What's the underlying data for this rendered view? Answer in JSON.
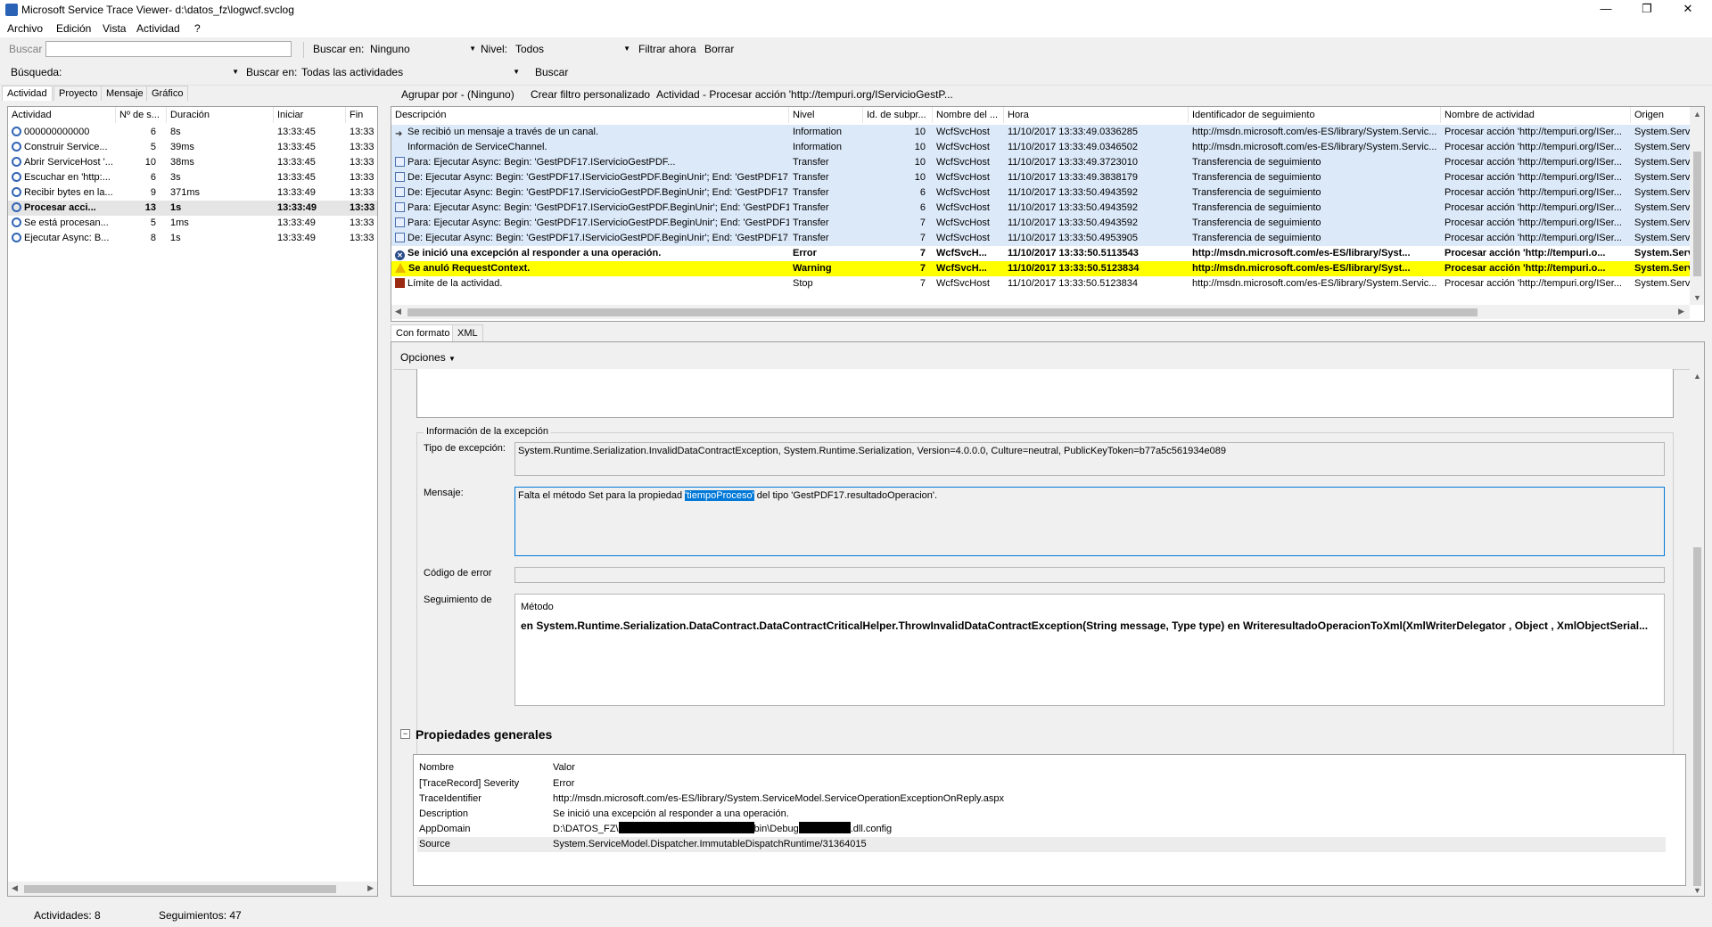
{
  "window": {
    "title": "Microsoft Service Trace Viewer- d:\\datos_fz\\logwcf.svclog",
    "minimize": "—",
    "maximize": "❐",
    "close": "✕"
  },
  "menu": [
    "Archivo",
    "Edición",
    "Vista",
    "Actividad",
    "?"
  ],
  "toolbar1": {
    "search_label": "Buscar",
    "search_value": "",
    "search_in_label": "Buscar en:",
    "search_in_value": "Ninguno",
    "level_label": "Nivel:",
    "level_value": "Todos",
    "filter_now": "Filtrar ahora",
    "clear": "Borrar"
  },
  "toolbar2": {
    "search_label": "Búsqueda:",
    "search_value": "",
    "search_in_label": "Buscar en:",
    "search_in_value": "Todas las actividades",
    "search_button": "Buscar"
  },
  "left_tabs": [
    "Actividad",
    "Proyecto",
    "Mensaje",
    "Gráfico"
  ],
  "right_toolbar": {
    "group_by": "Agrupar por - (Ninguno)",
    "create_filter": "Crear filtro personalizado",
    "activity": "Actividad - Procesar acción 'http://tempuri.org/IServicioGestP..."
  },
  "activity_list": {
    "headers": [
      "Actividad",
      "Nº de s...",
      "Duración",
      "Iniciar",
      "Fin"
    ],
    "rows": [
      {
        "icon": "activity",
        "name": "000000000000",
        "count": "6",
        "duration": "8s",
        "start": "13:33:45",
        "end": "13:33",
        "bold": false
      },
      {
        "icon": "activity",
        "name": "Construir Service...",
        "count": "5",
        "duration": "39ms",
        "start": "13:33:45",
        "end": "13:33",
        "bold": false
      },
      {
        "icon": "activity",
        "name": "Abrir ServiceHost '...",
        "count": "10",
        "duration": "38ms",
        "start": "13:33:45",
        "end": "13:33",
        "bold": false
      },
      {
        "icon": "activity",
        "name": "Escuchar en 'http:...",
        "count": "6",
        "duration": "3s",
        "start": "13:33:45",
        "end": "13:33",
        "bold": false
      },
      {
        "icon": "activity",
        "name": "Recibir bytes en la...",
        "count": "9",
        "duration": "371ms",
        "start": "13:33:49",
        "end": "13:33",
        "bold": false
      },
      {
        "icon": "activity",
        "name": "Procesar acci...",
        "count": "13",
        "duration": "1s",
        "start": "13:33:49",
        "end": "13:33",
        "bold": true
      },
      {
        "icon": "activity",
        "name": "Se está procesan...",
        "count": "5",
        "duration": "1ms",
        "start": "13:33:49",
        "end": "13:33",
        "bold": false
      },
      {
        "icon": "activity",
        "name": "Ejecutar Async: B...",
        "count": "8",
        "duration": "1s",
        "start": "13:33:49",
        "end": "13:33",
        "bold": false
      }
    ]
  },
  "trace_list": {
    "headers": [
      "Descripción",
      "Nivel",
      "Id. de subpr...",
      "Nombre del ...",
      "Hora",
      "Identificador de seguimiento",
      "Nombre de actividad",
      "Origen"
    ],
    "rows": [
      {
        "icon": "arrow",
        "desc": "Se recibió un mensaje a través de un canal.",
        "level": "Information",
        "tid": "10",
        "proc": "WcfSvcHost",
        "time": "11/10/2017 13:33:49.0336285",
        "trace": "http://msdn.microsoft.com/es-ES/library/System.Servic...",
        "act": "Procesar acción 'http://tempuri.org/ISer...",
        "src": "System.Servic",
        "style": "blue"
      },
      {
        "icon": "blank",
        "desc": "Información de ServiceChannel.",
        "level": "Information",
        "tid": "10",
        "proc": "WcfSvcHost",
        "time": "11/10/2017 13:33:49.0346502",
        "trace": "http://msdn.microsoft.com/es-ES/library/System.Servic...",
        "act": "Procesar acción 'http://tempuri.org/ISer...",
        "src": "System.Servic",
        "style": "blue"
      },
      {
        "icon": "msg",
        "desc": "Para: Ejecutar Async: Begin: 'GestPDF17.IServicioGestPDF...",
        "level": "Transfer",
        "tid": "10",
        "proc": "WcfSvcHost",
        "time": "11/10/2017 13:33:49.3723010",
        "trace": "Transferencia de seguimiento",
        "act": "Procesar acción 'http://tempuri.org/ISer...",
        "src": "System.Servic",
        "style": "blue"
      },
      {
        "icon": "msg",
        "desc": "De: Ejecutar Async: Begin: 'GestPDF17.IServicioGestPDF.BeginUnir'; End: 'GestPDF17...",
        "level": "Transfer",
        "tid": "10",
        "proc": "WcfSvcHost",
        "time": "11/10/2017 13:33:49.3838179",
        "trace": "Transferencia de seguimiento",
        "act": "Procesar acción 'http://tempuri.org/ISer...",
        "src": "System.Servic",
        "style": "blue"
      },
      {
        "icon": "msg",
        "desc": "De: Ejecutar Async: Begin: 'GestPDF17.IServicioGestPDF.BeginUnir'; End: 'GestPDF17...",
        "level": "Transfer",
        "tid": "6",
        "proc": "WcfSvcHost",
        "time": "11/10/2017 13:33:50.4943592",
        "trace": "Transferencia de seguimiento",
        "act": "Procesar acción 'http://tempuri.org/ISer...",
        "src": "System.Servic",
        "style": "blue"
      },
      {
        "icon": "msg",
        "desc": "Para: Ejecutar Async: Begin: 'GestPDF17.IServicioGestPDF.BeginUnir'; End: 'GestPDF17...",
        "level": "Transfer",
        "tid": "6",
        "proc": "WcfSvcHost",
        "time": "11/10/2017 13:33:50.4943592",
        "trace": "Transferencia de seguimiento",
        "act": "Procesar acción 'http://tempuri.org/ISer...",
        "src": "System.Servic",
        "style": "blue"
      },
      {
        "icon": "msg",
        "desc": "Para: Ejecutar Async: Begin: 'GestPDF17.IServicioGestPDF.BeginUnir'; End: 'GestPDF17...",
        "level": "Transfer",
        "tid": "7",
        "proc": "WcfSvcHost",
        "time": "11/10/2017 13:33:50.4943592",
        "trace": "Transferencia de seguimiento",
        "act": "Procesar acción 'http://tempuri.org/ISer...",
        "src": "System.Servic",
        "style": "blue"
      },
      {
        "icon": "msg",
        "desc": "De: Ejecutar Async: Begin: 'GestPDF17.IServicioGestPDF.BeginUnir'; End: 'GestPDF17...",
        "level": "Transfer",
        "tid": "7",
        "proc": "WcfSvcHost",
        "time": "11/10/2017 13:33:50.4953905",
        "trace": "Transferencia de seguimiento",
        "act": "Procesar acción 'http://tempuri.org/ISer...",
        "src": "System.Servic",
        "style": "blue"
      },
      {
        "icon": "error",
        "desc": "Se inició una excepción al responder a una operación.",
        "level": "Error",
        "tid": "7",
        "proc": "WcfSvcH...",
        "time": "11/10/2017 13:33:50.5113543",
        "trace": "http://msdn.microsoft.com/es-ES/library/Syst...",
        "act": "Procesar acción 'http://tempuri.o...",
        "src": "System.Serv",
        "style": "bold"
      },
      {
        "icon": "warning",
        "desc": "Se anuló RequestContext.",
        "level": "Warning",
        "tid": "7",
        "proc": "WcfSvcH...",
        "time": "11/10/2017 13:33:50.5123834",
        "trace": "http://msdn.microsoft.com/es-ES/library/Syst...",
        "act": "Procesar acción 'http://tempuri.o...",
        "src": "System.Serv",
        "style": "yellow"
      },
      {
        "icon": "stop",
        "desc": "Límite de la actividad.",
        "level": "Stop",
        "tid": "7",
        "proc": "WcfSvcHost",
        "time": "11/10/2017 13:33:50.5123834",
        "trace": "http://msdn.microsoft.com/es-ES/library/System.Servic...",
        "act": "Procesar acción 'http://tempuri.org/ISer...",
        "src": "System.Servic",
        "style": "plain"
      }
    ]
  },
  "detail_tabs": [
    "Con formato",
    "XML"
  ],
  "options_label": "Opciones",
  "exception": {
    "group_title": "Información de la excepción",
    "type_label": "Tipo de excepción:",
    "type_value": "System.Runtime.Serialization.InvalidDataContractException, System.Runtime.Serialization, Version=4.0.0.0, Culture=neutral, PublicKeyToken=b77a5c561934e089",
    "message_label": "Mensaje:",
    "message_before": "Falta el método Set para la propiedad ",
    "message_highlight": "'tiempoProceso'",
    "message_after": " del tipo 'GestPDF17.resultadoOperacion'.",
    "error_code_label": "Código de error",
    "error_code_value": "",
    "stack_label": "Seguimiento de",
    "stack_header": "Método",
    "stack_line": "en System.Runtime.Serialization.DataContract.DataContractCriticalHelper.ThrowInvalidDataContractException(String message, Type type)   en WriteresultadoOperacionToXml(XmlWriterDelegator , Object , XmlObjectSerial..."
  },
  "properties": {
    "title": "Propiedades generales",
    "collapse": "−",
    "headers": [
      "Nombre",
      "Valor"
    ],
    "rows": [
      {
        "name": "[TraceRecord] Severity",
        "value": "Error"
      },
      {
        "name": "TraceIdentifier",
        "value": "http://msdn.microsoft.com/es-ES/library/System.ServiceModel.ServiceOperationExceptionOnReply.aspx"
      },
      {
        "name": "Description",
        "value": "Se inició una excepción al responder a una operación."
      },
      {
        "name": "AppDomain",
        "value": "D:\\DATOS_FZ\\",
        "value2": "bin\\Debug",
        "value3": ".dll.config"
      },
      {
        "name": "Source",
        "value": "System.ServiceModel.Dispatcher.ImmutableDispatchRuntime/31364015"
      }
    ]
  },
  "status": {
    "activities": "Actividades: 8",
    "traces": "Seguimientos: 47"
  },
  "colors": {
    "blue_row": "#dce9f9",
    "yellow_row": "#ffff00",
    "selection": "#0078d7"
  }
}
